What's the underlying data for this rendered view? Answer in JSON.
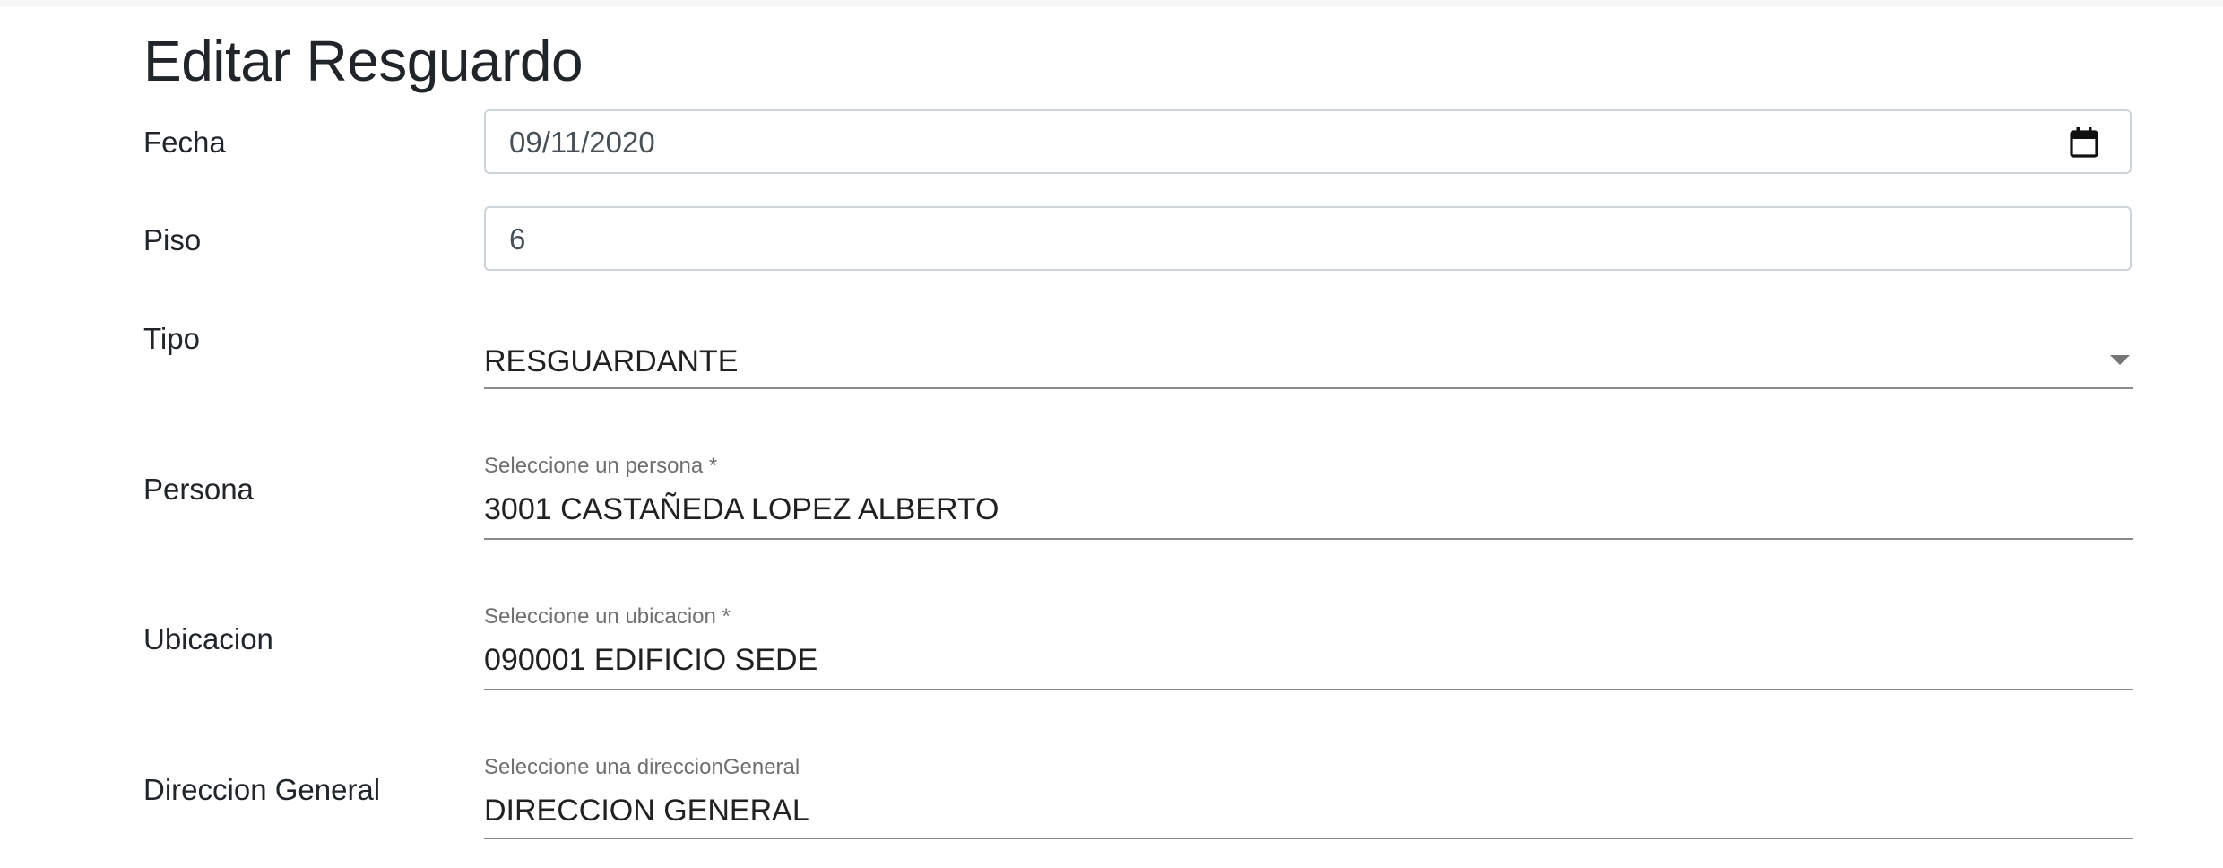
{
  "page": {
    "title": "Editar Resguardo"
  },
  "form": {
    "fecha": {
      "label": "Fecha",
      "value": "09/11/2020"
    },
    "piso": {
      "label": "Piso",
      "value": "6"
    },
    "tipo": {
      "label": "Tipo",
      "value": "RESGUARDANTE"
    },
    "persona": {
      "label": "Persona",
      "placeholder": "Seleccione un persona *",
      "value": "3001 CASTAÑEDA LOPEZ ALBERTO"
    },
    "ubicacion": {
      "label": "Ubicacion",
      "placeholder": "Seleccione un ubicacion *",
      "value": "090001 EDIFICIO SEDE"
    },
    "direccion_general": {
      "label": "Direccion General",
      "placeholder": "Seleccione una direccionGeneral",
      "value": "DIRECCION GENERAL"
    }
  },
  "icons": {
    "date_picker": "calendar-icon",
    "select": "chevron-down-icon"
  }
}
